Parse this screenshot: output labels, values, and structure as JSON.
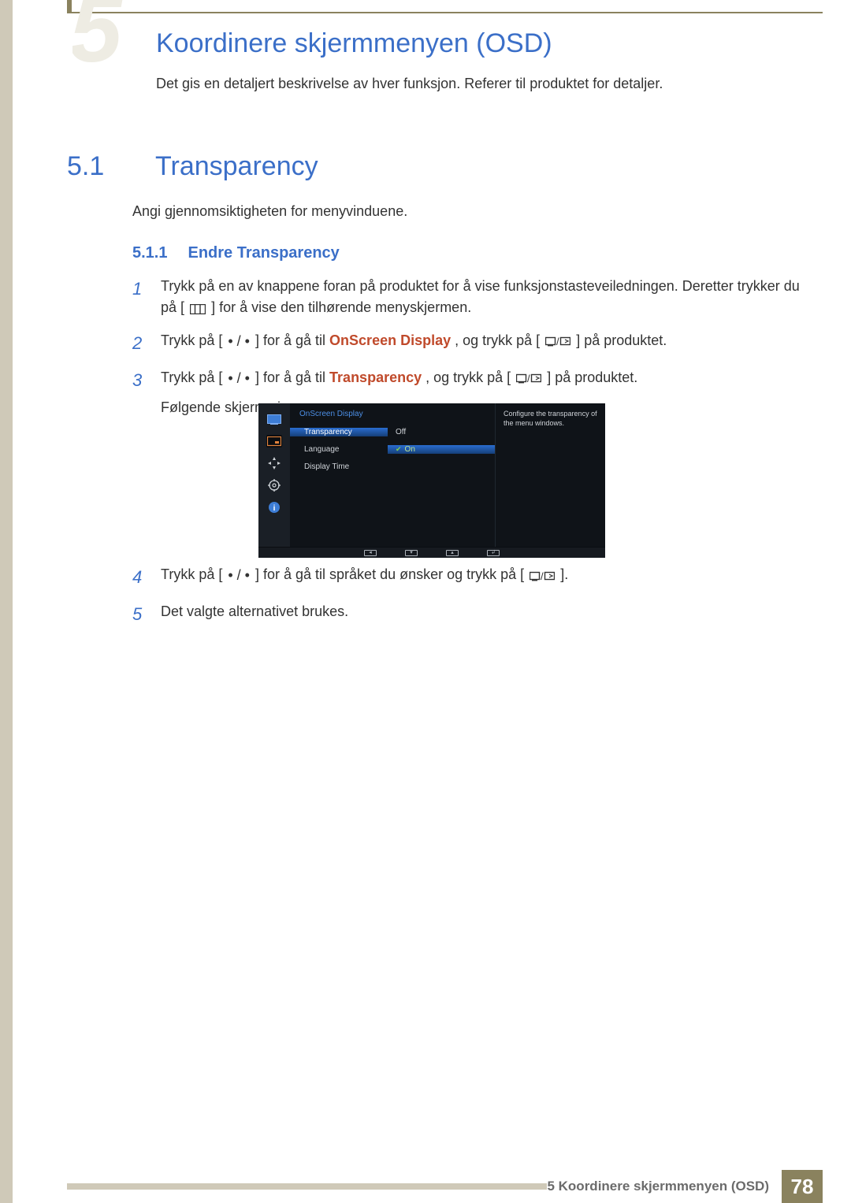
{
  "chapter": {
    "number": "5",
    "title": "Koordinere skjermmenyen (OSD)"
  },
  "intro": "Det gis en detaljert beskrivelse av hver funksjon. Referer til produktet for detaljer.",
  "section": {
    "number": "5.1",
    "title": "Transparency",
    "body": "Angi gjennomsiktigheten for menyvinduene."
  },
  "subsection": {
    "number": "5.1.1",
    "title": "Endre Transparency"
  },
  "steps": {
    "s1": "Trykk på en av knappene foran på produktet for å vise funksjonstasteveiledningen. Deretter trykker du på [",
    "s1b": "] for å vise den tilhørende menyskjermen.",
    "s2a": "Trykk på [",
    "s2b": "] for å gå til ",
    "s2em": "OnScreen Display",
    "s2c": ", og trykk på [",
    "s2d": "] på produktet.",
    "s3a": "Trykk på [",
    "s3b": "] for å gå til ",
    "s3em": "Transparency",
    "s3c": ", og trykk på [",
    "s3d": "] på produktet.",
    "s3e": "Følgende skjerm vises.",
    "s4a": "Trykk på [",
    "s4b": "] for å gå til språket du ønsker og trykk på [",
    "s4c": "].",
    "s5": "Det valgte alternativet brukes."
  },
  "osd": {
    "title": "OnScreen Display",
    "rows": {
      "transparency": "Transparency",
      "language": "Language",
      "displaytime": "Display Time"
    },
    "values": {
      "off": "Off",
      "on": "On"
    },
    "desc": "Configure the transparency of the menu windows."
  },
  "footer": {
    "label": "5 Koordinere skjermmenyen (OSD)",
    "page": "78"
  }
}
